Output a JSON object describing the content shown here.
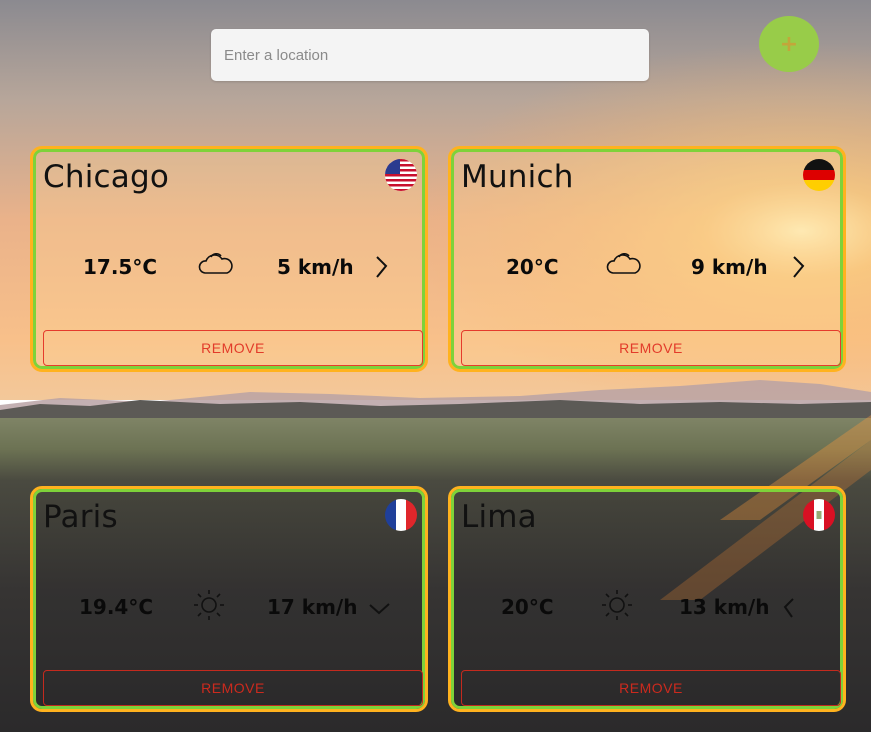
{
  "search": {
    "placeholder": "Enter a location",
    "value": ""
  },
  "add_button": {
    "label": "+",
    "color": "#98cc49"
  },
  "colors": {
    "card_border_outer": "#ffb21e",
    "card_border_inner": "#7ed23a",
    "remove": "#e23b2a"
  },
  "cards": [
    {
      "city": "Chicago",
      "flag": "us-flag-icon",
      "temperature": "17.5°C",
      "weather": "cloud-icon",
      "wind": "5 km/h",
      "wind_direction": "arrow-right-icon",
      "remove_label": "REMOVE"
    },
    {
      "city": "Munich",
      "flag": "germany-flag-icon",
      "temperature": "20°C",
      "weather": "cloud-icon",
      "wind": "9 km/h",
      "wind_direction": "arrow-right-icon",
      "remove_label": "REMOVE"
    },
    {
      "city": "Paris",
      "flag": "france-flag-icon",
      "temperature": "19.4°C",
      "weather": "sun-icon",
      "wind": "17 km/h",
      "wind_direction": "arrow-down-icon",
      "remove_label": "REMOVE"
    },
    {
      "city": "Lima",
      "flag": "peru-flag-icon",
      "temperature": "20°C",
      "weather": "sun-icon",
      "wind": "13 km/h",
      "wind_direction": "arrow-left-icon",
      "remove_label": "REMOVE"
    }
  ]
}
